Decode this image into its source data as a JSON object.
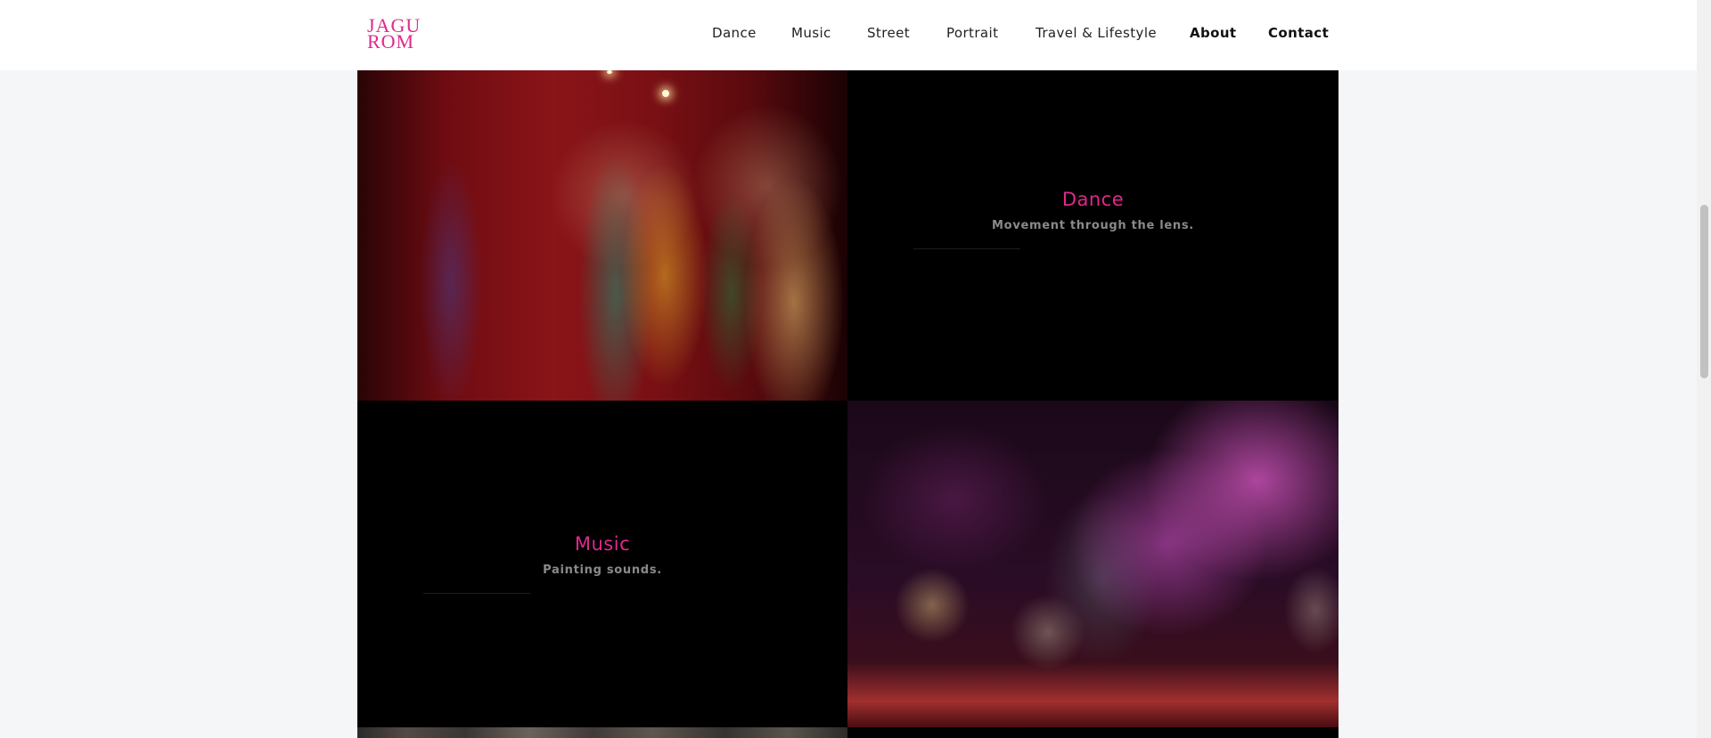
{
  "logo": {
    "line1": "JAGU",
    "line2": "ROM",
    "color": "#e0288c"
  },
  "nav": [
    {
      "label": "Dance",
      "bold": false
    },
    {
      "label": "Music",
      "bold": false
    },
    {
      "label": "Street",
      "bold": false
    },
    {
      "label": "Portrait",
      "bold": false
    },
    {
      "label": "Travel & Lifestyle",
      "bold": false
    },
    {
      "label": "About",
      "bold": true
    },
    {
      "label": "Contact",
      "bold": true
    }
  ],
  "tiles": {
    "dance": {
      "title": "Dance",
      "subtitle": "Movement through the lens."
    },
    "music": {
      "title": "Music",
      "subtitle": "Painting sounds."
    }
  },
  "photos": {
    "dance": "dance-performance-photo",
    "music": "music-concert-photo",
    "street": "street-photo"
  },
  "colors": {
    "accent": "#e0288c",
    "tile_background": "#000000",
    "page_background": "#f5f6f7"
  }
}
